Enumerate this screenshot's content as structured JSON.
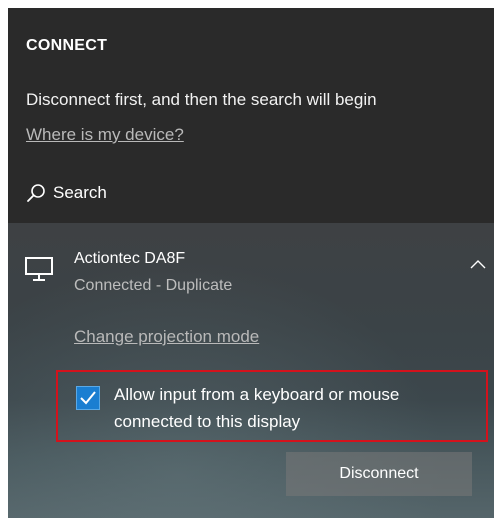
{
  "connect_panel": {
    "heading": "CONNECT",
    "instruction": "Disconnect first, and then the search will begin",
    "where_link": "Where is my device?",
    "search_label": "Search"
  },
  "device": {
    "name": "Actiontec DA8F",
    "status": "Connected - Duplicate",
    "projection_link": "Change projection mode",
    "allow_input": {
      "checked": true,
      "label_line1": "Allow input from a keyboard or mouse",
      "label_line2": "connected to this display"
    },
    "disconnect_label": "Disconnect"
  },
  "colors": {
    "accent": "#1a7ed1",
    "highlight": "#d4121c",
    "panel_background": "#2b2b2b"
  },
  "icons": {
    "search": "search-icon",
    "monitor": "monitor-icon",
    "collapse": "chevron-up-icon",
    "checkmark": "checkmark-icon"
  }
}
